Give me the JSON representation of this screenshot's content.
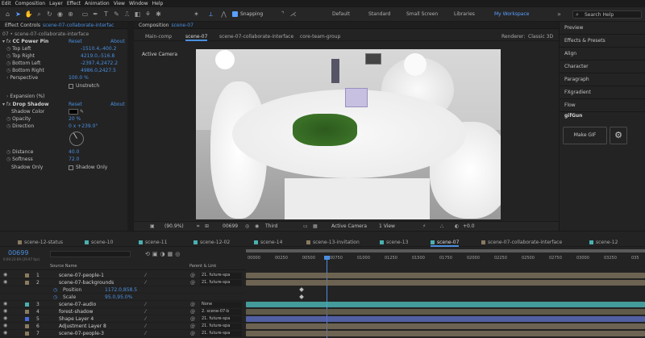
{
  "menu": [
    "Edit",
    "Composition",
    "Layer",
    "Effect",
    "Animation",
    "View",
    "Window",
    "Help"
  ],
  "toolbar": {
    "snapping": "Snapping",
    "workspaces": [
      "Default",
      "Standard",
      "Small Screen",
      "Libraries",
      "My Workspace"
    ],
    "search": "Search Help"
  },
  "effects": {
    "tab": "Effect Controls",
    "file": "scene-07-collaborate-interfac",
    "subtitle": "07 • scene-07-collaborate-interface",
    "cc": {
      "name": "CC Power Pin",
      "reset": "Reset",
      "about": "About"
    },
    "rows": [
      {
        "label": "Top Left",
        "value": "-1510.4,-400.2"
      },
      {
        "label": "Top Right",
        "value": "4219.0,-516.8"
      },
      {
        "label": "Bottom Left",
        "value": "-2397.4,2472.2"
      },
      {
        "label": "Bottom Right",
        "value": "4986.0,2427.5"
      },
      {
        "label": "Perspective",
        "value": "100.0 %"
      }
    ],
    "unstretch": "Unstretch",
    "expansion": "Expansion (%)",
    "ds": {
      "name": "Drop Shadow",
      "reset": "Reset",
      "about": "About",
      "color_label": "Shadow Color",
      "opacity_label": "Opacity",
      "opacity": "20 %",
      "direction_label": "Direction",
      "direction": "0 x +239.0°",
      "distance_label": "Distance",
      "distance": "40.0",
      "softness_label": "Softness",
      "softness": "72.0",
      "only_label": "Shadow Only",
      "only_check": "Shadow Only"
    }
  },
  "comp": {
    "tab": "Composition",
    "name": "scene-07",
    "tabs": [
      "Main-comp",
      "scene-07",
      "scene-07-collaborate-interface",
      "core-team-group"
    ],
    "renderer_label": "Renderer:",
    "renderer": "Classic 3D",
    "camera": "Active Camera",
    "zoom": "(90.9%)",
    "timecode": "00699",
    "resolution": "Third",
    "view_camera": "Active Camera",
    "views": "1 View",
    "exposure": "+0.0"
  },
  "right_panel": [
    "Preview",
    "Effects & Presets",
    "Align",
    "Character",
    "Paragraph",
    "FXgradient",
    "Flow"
  ],
  "gifgun": {
    "title": "gifGun",
    "button": "Make GIF"
  },
  "timeline": {
    "tabs": [
      {
        "name": "scene-12-status",
        "color": "#8a7a60"
      },
      {
        "name": "scene-10",
        "color": "#4ab0b0"
      },
      {
        "name": "scene-11",
        "color": "#4ab0b0"
      },
      {
        "name": "scene-12-02",
        "color": "#4ab0b0"
      },
      {
        "name": "scene-14",
        "color": "#4ab0b0"
      },
      {
        "name": "scene-13-invitation",
        "color": "#8a7a60"
      },
      {
        "name": "scene-13",
        "color": "#4ab0b0"
      },
      {
        "name": "scene-07",
        "color": "#4ab0b0"
      },
      {
        "name": "scene-07-collaborate-interface",
        "color": "#8a7a60"
      },
      {
        "name": "scene-12",
        "color": "#4ab0b0"
      }
    ],
    "timecode": "00699",
    "fps": "0:00:23:09 (29.97 fps)",
    "col_source": "Source Name",
    "col_parent": "Parent & Link",
    "ruler": [
      "00000",
      "00250",
      "00500",
      "00750",
      "01000",
      "01250",
      "01500",
      "01750",
      "02000",
      "02250",
      "02500",
      "02750",
      "03000",
      "03250",
      "035"
    ],
    "layers": [
      {
        "num": "1",
        "name": "scene-07-people-1",
        "parent": "21. future-spa",
        "color": "#8a7a60",
        "type": "layer"
      },
      {
        "num": "2",
        "name": "scene-07-backgrounds",
        "parent": "21. future-spa",
        "color": "#8a7a60",
        "type": "layer"
      },
      {
        "num": "",
        "name": "Position",
        "value": "1172.0,858.5",
        "type": "prop"
      },
      {
        "num": "",
        "name": "Scale",
        "value": "95.0,95.0%",
        "type": "prop"
      },
      {
        "num": "3",
        "name": "scene-07-audio",
        "parent": "None",
        "color": "#4ab0b0",
        "type": "layer"
      },
      {
        "num": "4",
        "name": "forest-shadow",
        "parent": "2. scene-07-b",
        "color": "#8a7a60",
        "type": "layer"
      },
      {
        "num": "5",
        "name": "Shape Layer 4",
        "parent": "21. future-spa",
        "color": "#4a6adb",
        "type": "layer"
      },
      {
        "num": "6",
        "name": "Adjustment Layer 8",
        "parent": "21. future-spa",
        "color": "#8a7a60",
        "type": "layer"
      },
      {
        "num": "7",
        "name": "scene-07-people-3",
        "parent": "21. future-spa",
        "color": "#8a7a60",
        "type": "layer"
      }
    ]
  }
}
